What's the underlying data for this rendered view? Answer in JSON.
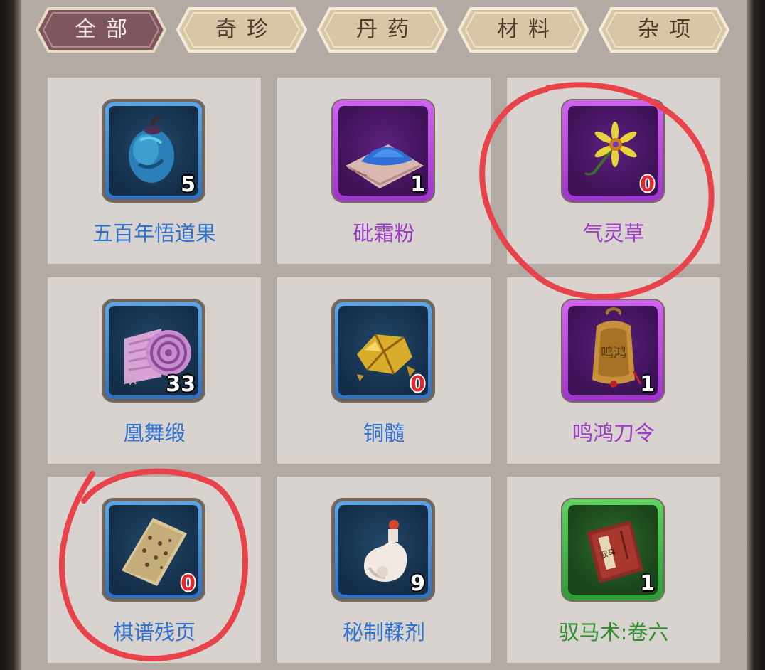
{
  "tabs": [
    {
      "label": "全部",
      "active": true
    },
    {
      "label": "奇珍",
      "active": false
    },
    {
      "label": "丹药",
      "active": false
    },
    {
      "label": "材料",
      "active": false
    },
    {
      "label": "杂项",
      "active": false
    }
  ],
  "items": [
    {
      "name": "五百年悟道果",
      "count": "5",
      "rarity": "blue",
      "icon": "fruit-icon"
    },
    {
      "name": "砒霜粉",
      "count": "1",
      "rarity": "purple",
      "icon": "powder-icon"
    },
    {
      "name": "气灵草",
      "count": "0",
      "rarity": "purple",
      "icon": "herb-icon"
    },
    {
      "name": "凰舞缎",
      "count": "33",
      "rarity": "blue",
      "icon": "silk-roll-icon"
    },
    {
      "name": "铜髓",
      "count": "0",
      "rarity": "blue",
      "icon": "copper-ore-icon"
    },
    {
      "name": "鸣鸿刀令",
      "count": "1",
      "rarity": "purple",
      "icon": "bell-token-icon"
    },
    {
      "name": "棋谱残页",
      "count": "0",
      "rarity": "blue",
      "icon": "scroll-page-icon"
    },
    {
      "name": "秘制鞣剂",
      "count": "9",
      "rarity": "blue",
      "icon": "potion-bottle-icon"
    },
    {
      "name": "驭马术:卷六",
      "count": "1",
      "rarity": "green",
      "icon": "book-icon"
    }
  ],
  "colors": {
    "rarity_blue": "#2f71cf",
    "rarity_purple": "#9c3bc6",
    "rarity_green": "#2e8f2f",
    "zero_count": "#e8262a",
    "annotation": "#e8424a"
  }
}
